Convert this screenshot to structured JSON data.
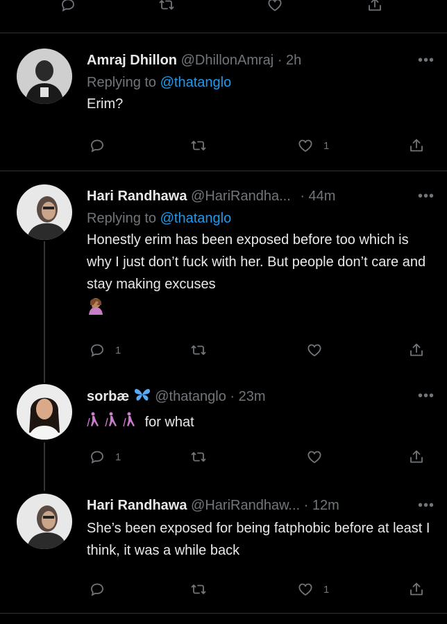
{
  "top_actions": {
    "icons": [
      "reply-icon",
      "retweet-icon",
      "like-icon",
      "share-icon"
    ]
  },
  "tweets": [
    {
      "name": "Amraj Dhillon",
      "handle": "@DhillonAmraj",
      "time": "· 2h",
      "replying_prefix": "Replying to ",
      "replying_handle": "@thatanglo",
      "text": "Erim?",
      "reply_count": "",
      "retweet_count": "",
      "like_count": "1"
    },
    {
      "name": "Hari Randhawa",
      "handle": "@HariRandha...",
      "time": "· 44m",
      "replying_prefix": "Replying to ",
      "replying_handle": "@thatanglo",
      "text": "Honestly erim has been exposed before too which is why I just don’t fuck with her. But people don’t care and stay making excuses",
      "reply_count": "1",
      "retweet_count": "",
      "like_count": ""
    },
    {
      "name": "sorbæ",
      "handle": "@thatanglo",
      "time": "· 23m",
      "text": "for what",
      "reply_count": "1",
      "retweet_count": "",
      "like_count": ""
    },
    {
      "name": "Hari Randhawa",
      "handle": "@HariRandhaw...",
      "time": "· 12m",
      "text": "She’s been exposed for being fatphobic before at least I think, it was a while back",
      "reply_count": "",
      "retweet_count": "",
      "like_count": "1"
    }
  ],
  "colors": {
    "background": "#000000",
    "text": "#e7e9ea",
    "muted": "#71767b",
    "link": "#1d9bf0",
    "separator": "#2f3336"
  }
}
